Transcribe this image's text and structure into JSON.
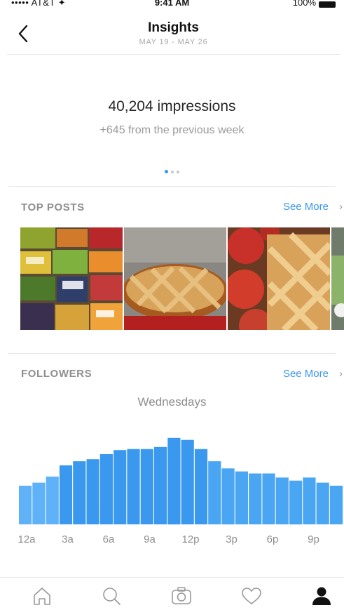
{
  "status_bar": {
    "carrier": "••••• AT&T ✦",
    "time": "9:41 AM",
    "battery": "100%"
  },
  "header": {
    "title": "Insights",
    "date_range": "MAY 19 - MAY 26"
  },
  "summary": {
    "impressions": "40,204 impressions",
    "delta": "+645 from the previous week",
    "page_dots": 3,
    "active_dot": 0
  },
  "top_posts": {
    "title": "TOP POSTS",
    "see_more": "See More",
    "posts": [
      {
        "image": "fruit-market-photo"
      },
      {
        "image": "lattice-pie-photo"
      },
      {
        "image": "apple-pie-photo"
      },
      {
        "image": "partial-photo"
      }
    ]
  },
  "followers": {
    "title": "FOLLOWERS",
    "see_more": "See More",
    "caption": "Wednesdays"
  },
  "chart_data": {
    "type": "bar",
    "title": "Wednesdays",
    "x_tick_labels": [
      "12a",
      "3a",
      "6a",
      "9a",
      "12p",
      "3p",
      "6p",
      "9p"
    ],
    "values": [
      38,
      41,
      47,
      58,
      62,
      64,
      69,
      73,
      74,
      74,
      76,
      85,
      83,
      74,
      62,
      55,
      52,
      50,
      50,
      46,
      43,
      46,
      41,
      38
    ],
    "ylim": [
      0,
      100
    ],
    "grid": false,
    "bar_colors": [
      "#5fb2f7",
      "#4aa5f3",
      "#3a99ef"
    ]
  },
  "tabbar": {
    "items": [
      {
        "icon": "home-icon"
      },
      {
        "icon": "search-icon"
      },
      {
        "icon": "camera-icon"
      },
      {
        "icon": "heart-icon"
      },
      {
        "icon": "profile-icon"
      }
    ]
  }
}
